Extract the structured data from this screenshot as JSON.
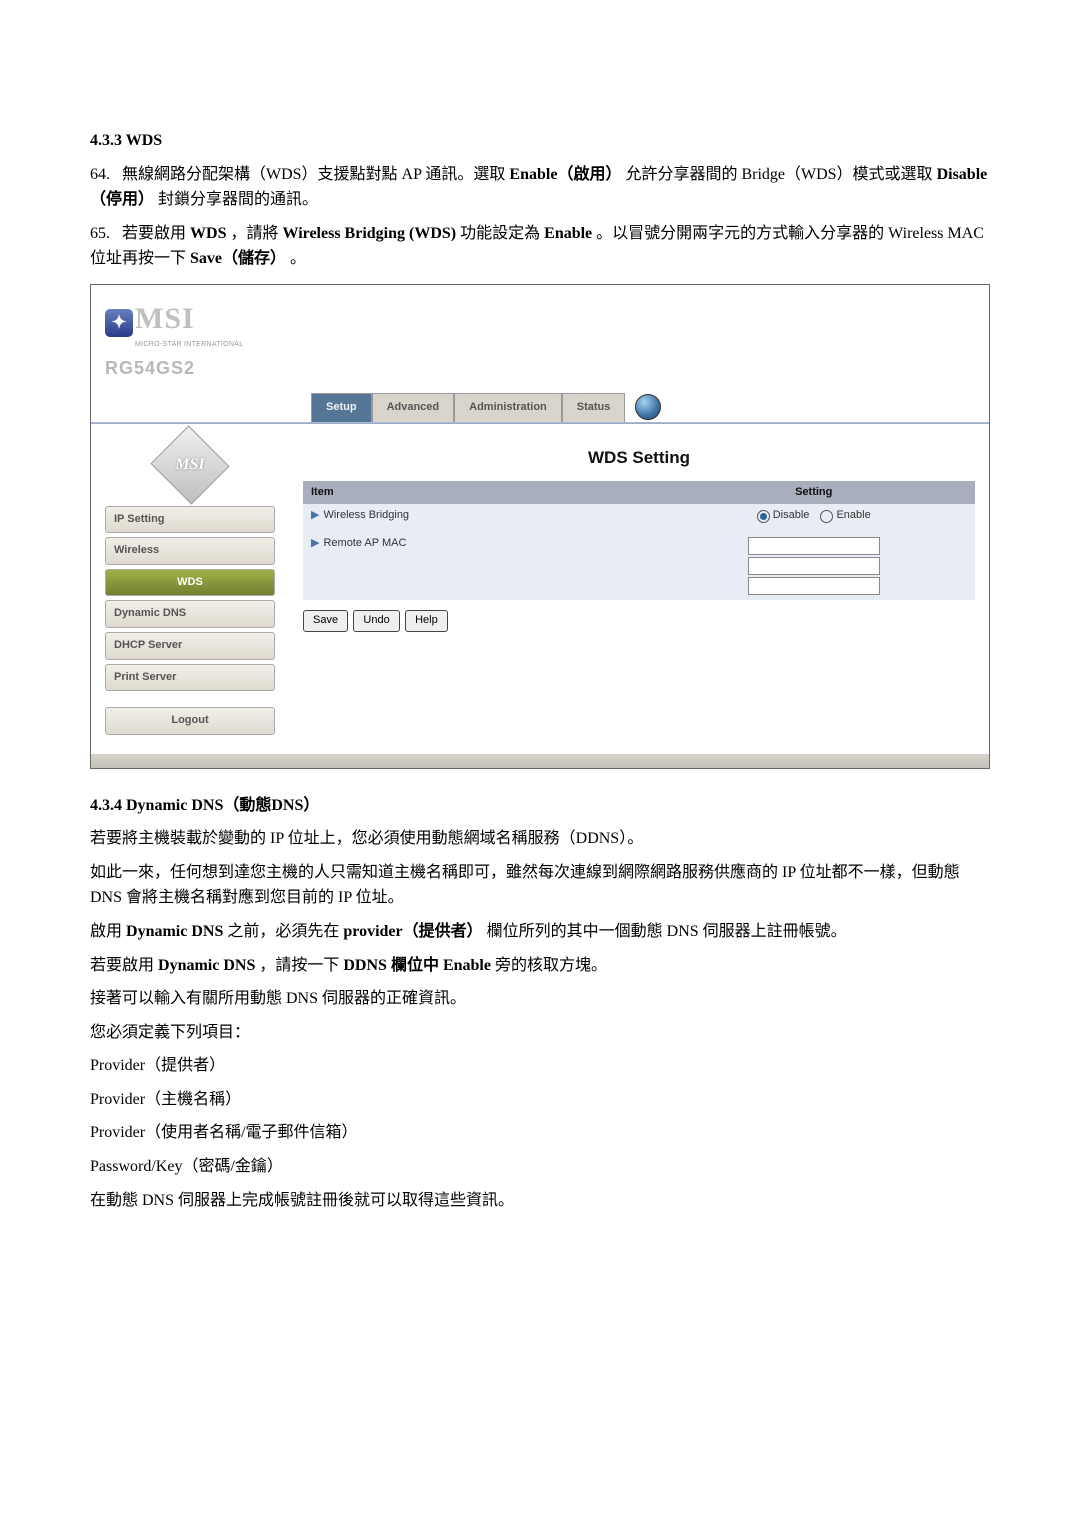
{
  "doc": {
    "section_wds": "4.3.3 WDS",
    "p1_num": "64.",
    "p1_a": "無線網路分配架構（WDS）支援點對點 AP 通訊。選取 ",
    "p1_b": "Enable（啟用）",
    "p1_c": "允許分享器間的 Bridge（WDS）模式或選取 ",
    "p1_d": "Disable（停用）",
    "p1_e": "封鎖分享器間的通訊。",
    "p2_num": "65.",
    "p2_a": "若要啟用 ",
    "p2_b": "WDS",
    "p2_c": "，請將 ",
    "p2_d": "Wireless Bridging (WDS)",
    "p2_e": " 功能設定為 ",
    "p2_f": "Enable",
    "p2_g": "。以冒號分開兩字元的方式輸入分享器的 Wireless MAC 位址再按一下 ",
    "p2_h": "Save（儲存）",
    "p2_i": "。",
    "section_ddns": "4.3.4 Dynamic DNS（動態DNS）",
    "d1": "若要將主機裝載於變動的 IP 位址上，您必須使用動態網域名稱服務（DDNS）。",
    "d2": "如此一來，任何想到達您主機的人只需知道主機名稱即可，雖然每次連線到網際網路服務供應商的 IP 位址都不一樣，但動態 DNS 會將主機名稱對應到您目前的 IP 位址。",
    "d3_a": "啟用 ",
    "d3_b": "Dynamic DNS",
    "d3_c": " 之前，必須先在 ",
    "d3_d": "provider（提供者）",
    "d3_e": "欄位所列的其中一個動態 DNS 伺服器上註冊帳號。",
    "d4_a": "若要啟用 ",
    "d4_b": "Dynamic DNS",
    "d4_c": "，請按一下 ",
    "d4_d": "DDNS 欄位中 Enable",
    "d4_e": " 旁的核取方塊。",
    "d5": "接著可以輸入有關所用動態 DNS 伺服器的正確資訊。",
    "d6": "您必須定義下列項目：",
    "d7": "Provider（提供者）",
    "d8": "Provider（主機名稱）",
    "d9": "Provider（使用者名稱/電子郵件信箱）",
    "d10": "Password/Key（密碼/金鑰）",
    "d11": "在動態 DNS 伺服器上完成帳號註冊後就可以取得這些資訊。"
  },
  "ui": {
    "logo_text": "MSI",
    "logo_sub": "MICRO-STAR INTERNATIONAL",
    "logo_star": "✦",
    "product": "RG54GS2",
    "chip": "MSI",
    "tabs": {
      "setup": "Setup",
      "advanced": "Advanced",
      "administration": "Administration",
      "status": "Status"
    },
    "sidebar": {
      "ip": "IP Setting",
      "wireless": "Wireless",
      "wds": "WDS",
      "ddns": "Dynamic DNS",
      "dhcp": "DHCP Server",
      "print": "Print Server",
      "logout": "Logout"
    },
    "panel": {
      "title": "WDS Setting",
      "col_item": "Item",
      "col_setting": "Setting",
      "bridging_marker": "▶",
      "bridging": "Wireless Bridging",
      "remote_marker": "▶",
      "remote": "Remote AP MAC",
      "disable": "Disable",
      "enable": "Enable",
      "btn_save": "Save",
      "btn_undo": "Undo",
      "btn_help": "Help"
    }
  }
}
